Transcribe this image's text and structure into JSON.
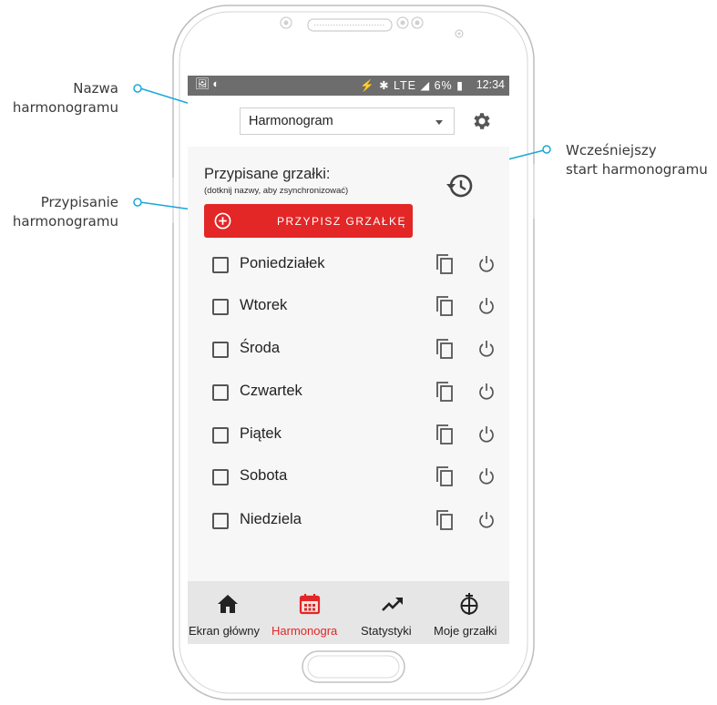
{
  "callouts": {
    "schedule_name_line1": "Nazwa",
    "schedule_name_line2": "harmonogramu",
    "assign_line1": "Przypisanie",
    "assign_line2": "harmonogramu",
    "early_start_line1": "Wcześniejszy",
    "early_start_line2": "start harmonogramu"
  },
  "status_bar": {
    "icons_left": "🖼 ◐",
    "icons_right": "⚡ ✱ LTE ◢ 6% ▮",
    "time": "12:34"
  },
  "schedule_select": {
    "value": "Harmonogram"
  },
  "assigned": {
    "title": "Przypisane grzałki:",
    "hint": "(dotknij nazwy, aby zsynchronizować)",
    "assign_button": "PRZYPISZ GRZAŁKĘ"
  },
  "days": [
    "Poniedziałek",
    "Wtorek",
    "Środa",
    "Czwartek",
    "Piątek",
    "Sobota",
    "Niedziela"
  ],
  "bottom_nav": [
    {
      "label": "Ekran główny",
      "icon": "home-icon",
      "active": false
    },
    {
      "label": "Harmonogra",
      "icon": "calendar-icon",
      "active": true
    },
    {
      "label": "Statystyki",
      "icon": "trending-up-icon",
      "active": false
    },
    {
      "label": "Moje grzałki",
      "icon": "heater-icon",
      "active": false
    }
  ],
  "colors": {
    "accent": "#e32626",
    "callout_line": "#1aa7d8",
    "status_bar": "#6d6d6d"
  }
}
